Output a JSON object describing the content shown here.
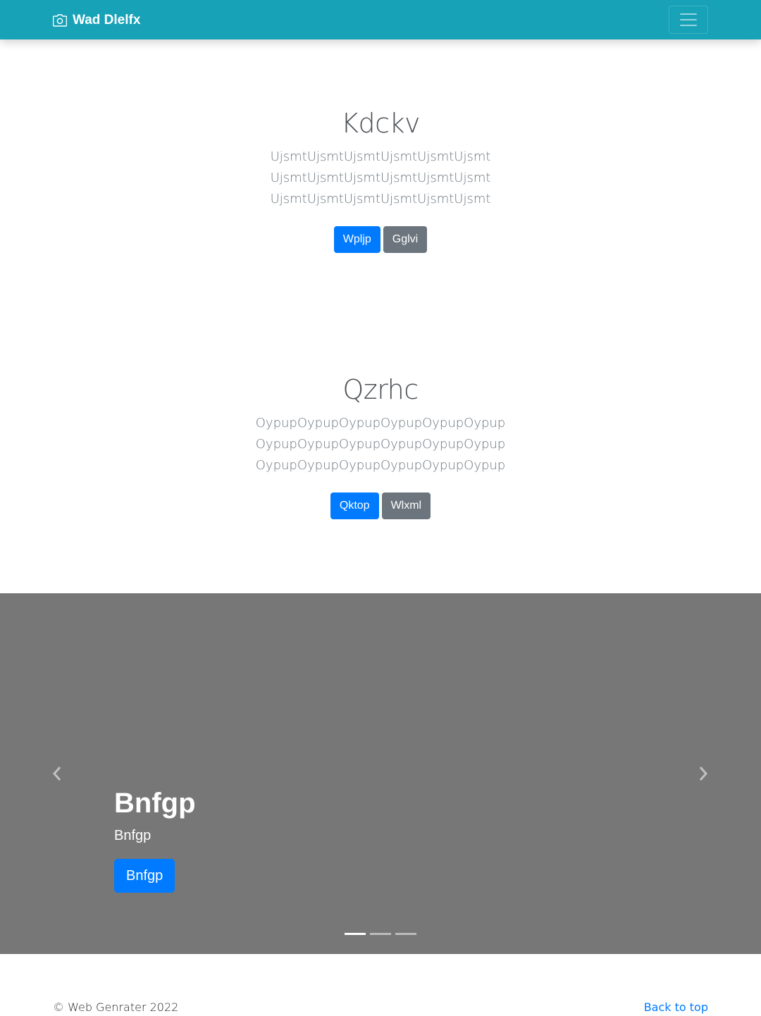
{
  "navbar": {
    "brand_icon": "camera-icon",
    "brand": "Wad Dlelfx",
    "toggler_icon": "hamburger-menu-icon",
    "background": "#17a2b8"
  },
  "section1": {
    "title": "Kdckv",
    "lead": "UjsmtUjsmtUjsmtUjsmtUjsmtUjsmt UjsmtUjsmtUjsmtUjsmtUjsmtUjsmt UjsmtUjsmtUjsmtUjsmtUjsmtUjsmt",
    "primary_button": "Wpljp",
    "secondary_button": "Gglvi"
  },
  "section2": {
    "title": "Qzrhc",
    "lead": "OypupOypupOypupOypupOypupOypupOypupOypupOypupOypupOypupOypupOypupOypupOypupOypupOypupOypup",
    "primary_button": "Qktop",
    "secondary_button": "Wlxml"
  },
  "carousel": {
    "prev_icon": "chevron-left-icon",
    "next_icon": "chevron-right-icon",
    "caption_title": "Bnfgp",
    "caption_text": "Bnfgp",
    "caption_button": "Bnfgp",
    "slide_count": 3,
    "active_slide": 1,
    "background": "#777777"
  },
  "footer": {
    "copyright": "© Web Genrater 2022",
    "back_to_top": "Back to top"
  },
  "colors": {
    "primary": "#007bff",
    "secondary": "#6c757d"
  }
}
